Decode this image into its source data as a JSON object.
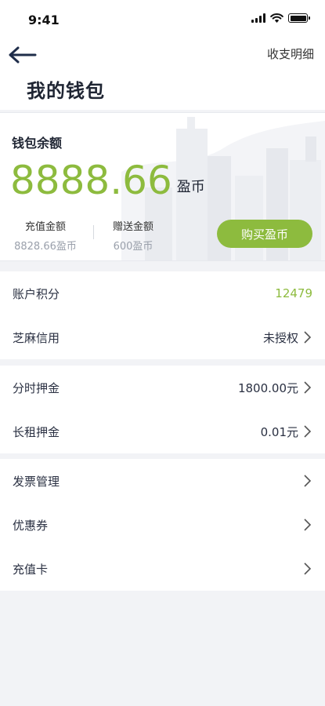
{
  "status": {
    "time": "9:41"
  },
  "header": {
    "detail_link": "收支明细",
    "title": "我的钱包"
  },
  "wallet": {
    "label": "钱包余额",
    "balance": "8888.66",
    "unit": "盈币",
    "recharge_label": "充值金额",
    "recharge_value": "8828.66盈币",
    "gift_label": "赠送金额",
    "gift_value": "600盈币",
    "buy_button": "购买盈币"
  },
  "group1": [
    {
      "label": "账户积分",
      "value": "12479"
    },
    {
      "label": "芝麻信用",
      "value": "未授权"
    }
  ],
  "group2": [
    {
      "label": "分时押金",
      "value": "1800.00元"
    },
    {
      "label": "长租押金",
      "value": "0.01元"
    }
  ],
  "group3": [
    {
      "label": "发票管理"
    },
    {
      "label": "优惠券"
    },
    {
      "label": "充值卡"
    }
  ],
  "colors": {
    "accent": "#8dbb3e",
    "text": "#2a3042",
    "background": "#f2f3f6"
  },
  "icons": [
    "signal-icon",
    "wifi-icon",
    "battery-icon",
    "back-arrow-icon",
    "chevron-right-icon"
  ]
}
